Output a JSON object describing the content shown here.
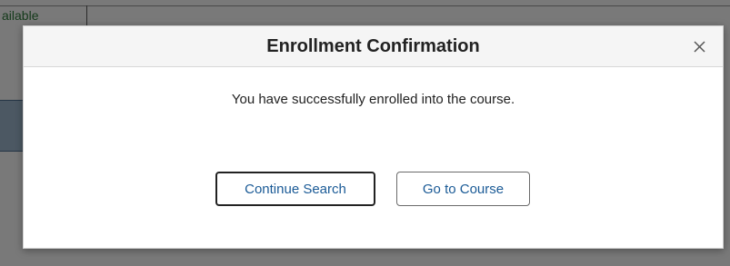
{
  "background": {
    "availability_text": "ailable"
  },
  "modal": {
    "title": "Enrollment Confirmation",
    "message": "You have successfully enrolled into the course.",
    "buttons": {
      "continue_search": "Continue Search",
      "go_to_course": "Go to Course"
    },
    "close_icon": "close-icon"
  },
  "colors": {
    "overlay": "#7a7a7a",
    "button_text": "#1a5a96",
    "title_text": "#222222"
  }
}
